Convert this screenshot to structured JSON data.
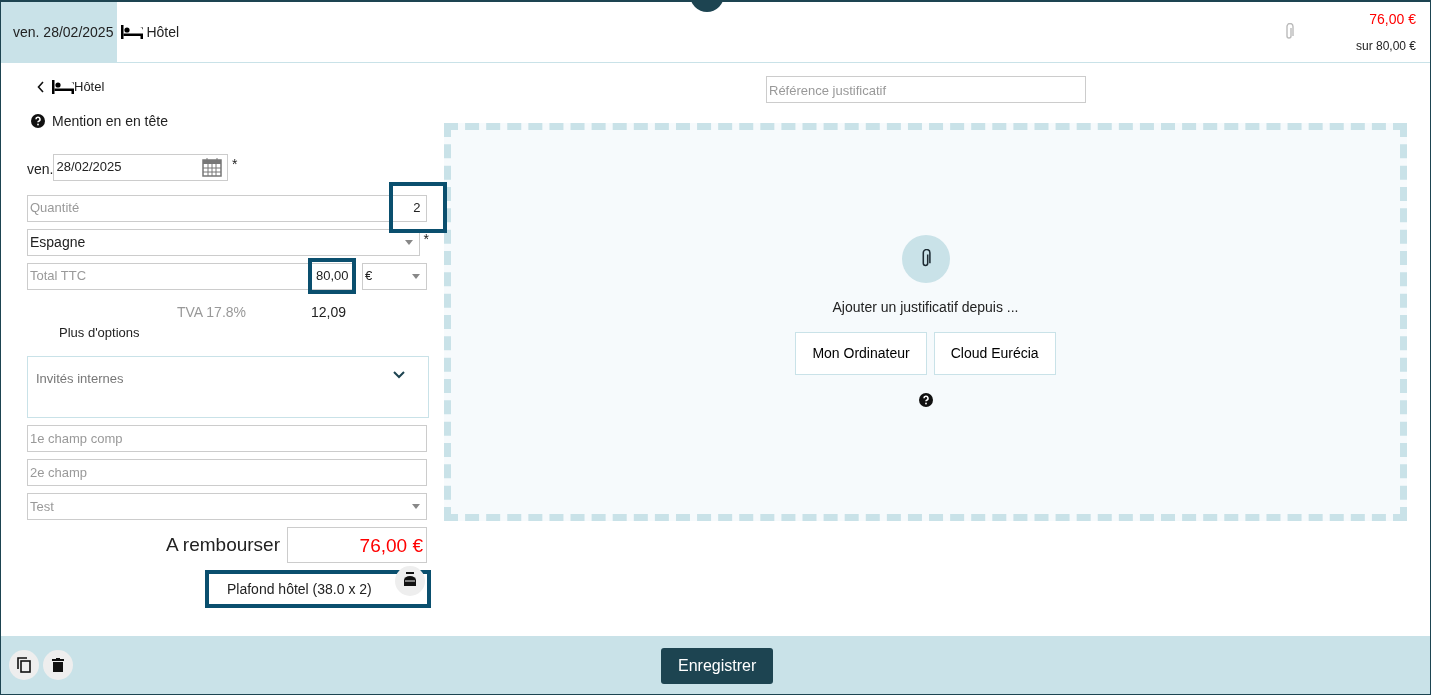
{
  "header": {
    "date": "ven. 28/02/2025",
    "category": "Hôtel",
    "amount": "76,00 €",
    "limit": "sur 80,00 €"
  },
  "form": {
    "back_label": "Hôtel",
    "mention": "Mention en en tête",
    "day": "ven.",
    "date": "28/02/2025",
    "date_required": "*",
    "quantity": {
      "placeholder": "Quantité",
      "value": "2",
      "highlighted": true
    },
    "country": {
      "value": "Espagne",
      "required": "*"
    },
    "total": {
      "placeholder": "Total TTC",
      "value": "80,00",
      "highlighted": true,
      "currency": "€"
    },
    "vat_label": "TVA 17.8%",
    "vat_amount": "12,09",
    "more_options": "Plus d'options",
    "guests": {
      "label": "Invités internes",
      "expanded": false
    },
    "extra_fields": [
      {
        "kind": "text",
        "placeholder": "1e champ comp"
      },
      {
        "kind": "text",
        "placeholder": "2e champ"
      },
      {
        "kind": "select",
        "placeholder": "Test"
      }
    ],
    "refund_label": "A rembourser",
    "refund_amount": "76,00 €",
    "cap": {
      "text": "Plafond hôtel (38.0 x 2)",
      "highlighted": true
    }
  },
  "upload": {
    "reference_placeholder": "Référence justificatif",
    "prompt": "Ajouter un justificatif depuis ...",
    "buttons": [
      "Mon Ordinateur",
      "Cloud Eurécia"
    ]
  },
  "footer": {
    "save": "Enregistrer"
  }
}
